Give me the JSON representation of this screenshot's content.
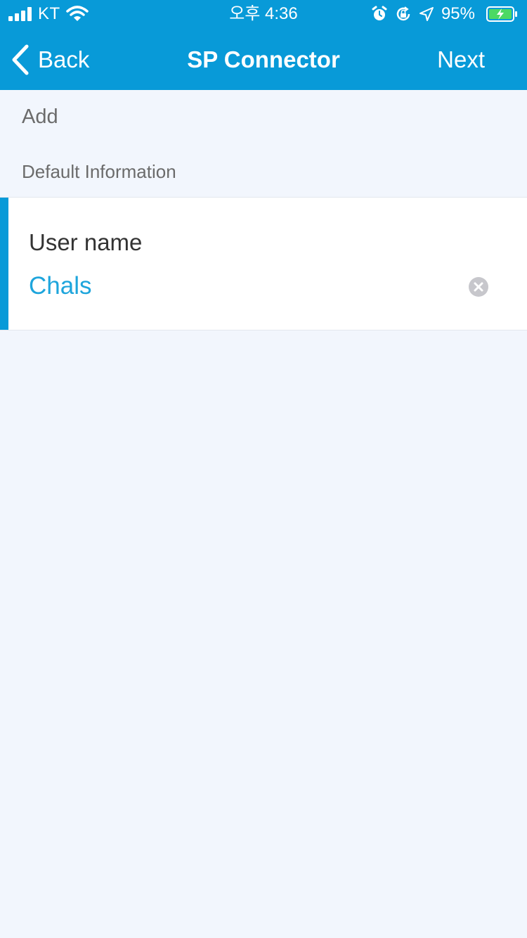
{
  "status_bar": {
    "carrier": "KT",
    "time": "오후 4:36",
    "battery_percent": "95%",
    "icons": [
      "signal-icon",
      "wifi-icon",
      "alarm-icon",
      "rotation-lock-icon",
      "location-icon",
      "battery-charging-icon"
    ]
  },
  "nav": {
    "back_label": "Back",
    "title": "SP Connector",
    "next_label": "Next",
    "back_icon": "chevron-left-icon"
  },
  "sections": {
    "add_label": "Add",
    "default_info_label": "Default Information"
  },
  "form": {
    "user_name_label": "User name",
    "user_name_value": "Chals",
    "clear_icon": "clear-icon"
  },
  "colors": {
    "header": "#089ad8",
    "accent": "#089ad8",
    "value_text": "#1ea5dc",
    "background": "#f2f6fd",
    "battery_fill": "#4cd964"
  }
}
